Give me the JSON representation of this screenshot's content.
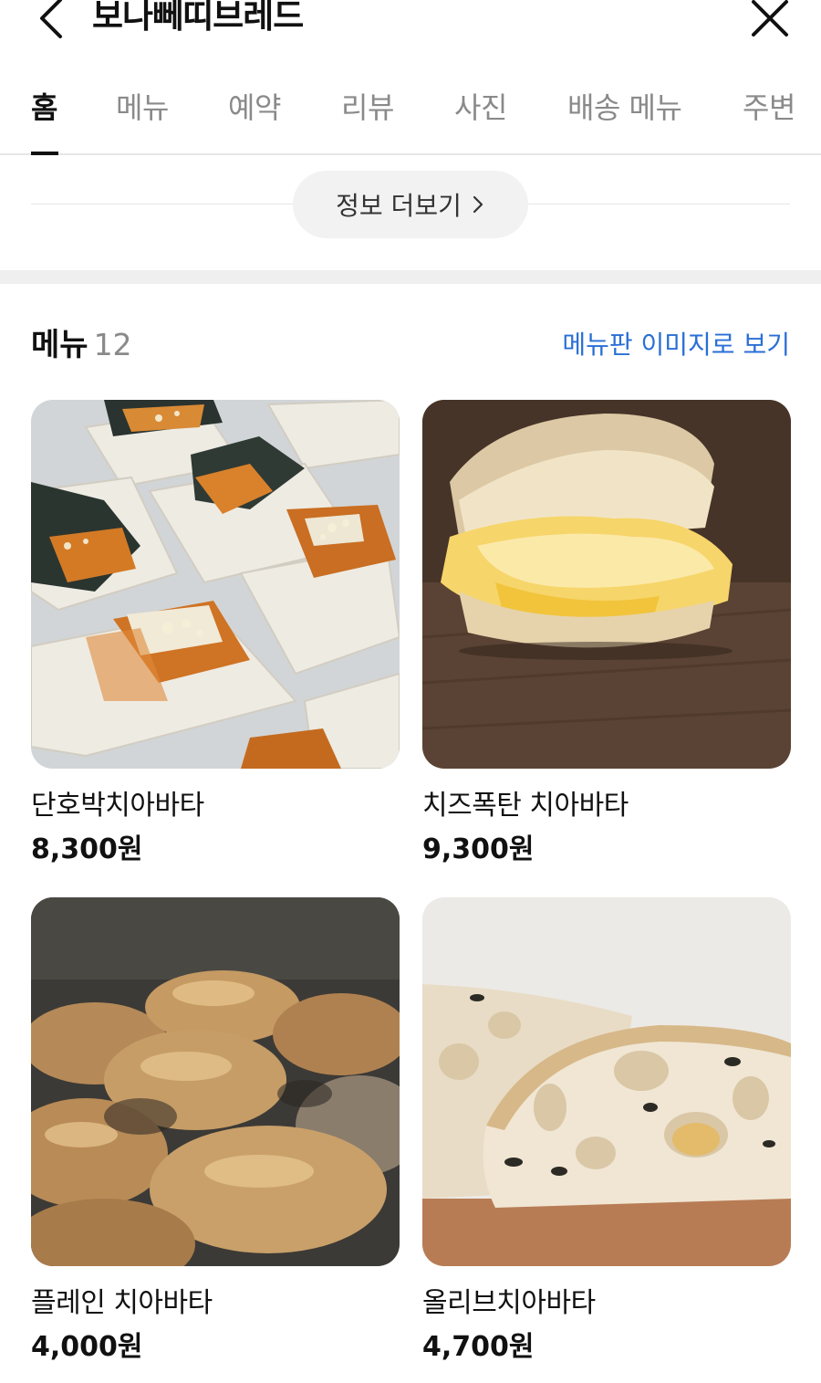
{
  "header": {
    "title": "보나뻬띠브레드",
    "back_icon": "chevron-left-icon",
    "close_icon": "close-icon"
  },
  "tabs": [
    {
      "label": "홈",
      "active": true
    },
    {
      "label": "메뉴",
      "active": false
    },
    {
      "label": "예약",
      "active": false
    },
    {
      "label": "리뷰",
      "active": false
    },
    {
      "label": "사진",
      "active": false
    },
    {
      "label": "배송 메뉴",
      "active": false
    },
    {
      "label": "주변",
      "active": false
    }
  ],
  "info": {
    "more_label": "정보 더보기",
    "more_icon": "chevron-right-icon"
  },
  "menu": {
    "title": "메뉴",
    "count": "12",
    "view_board_link": "메뉴판 이미지로 보기",
    "items": [
      {
        "name": "단호박치아바타",
        "price": "8,300원"
      },
      {
        "name": "치즈폭탄 치아바타",
        "price": "9,300원"
      },
      {
        "name": "플레인 치아바타",
        "price": "4,000원"
      },
      {
        "name": "올리브치아바타",
        "price": "4,700원"
      }
    ]
  },
  "colors": {
    "accent_link": "#2a6fd6",
    "active_tab": "#111111",
    "inactive_tab": "#8a8a8a"
  }
}
